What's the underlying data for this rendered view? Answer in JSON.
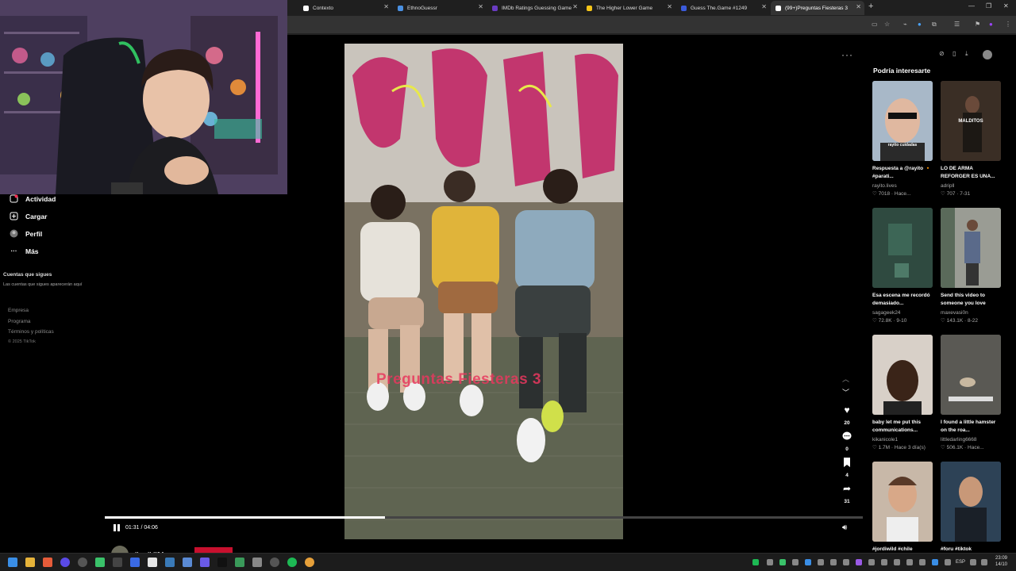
{
  "browser": {
    "tabs": [
      {
        "label": "Contexto",
        "color": "#ffffff"
      },
      {
        "label": "EthnoGuessr",
        "color": "#4a90e2"
      },
      {
        "label": "IMDb Ratings Guessing Game",
        "color": "#6a3cc2"
      },
      {
        "label": "The Higher Lower Game",
        "color": "#f5c518"
      },
      {
        "label": "Guess The.Game #1249",
        "color": "#3b5bdb"
      },
      {
        "label": "(99+)Preguntas Fiesteras 3",
        "color": "#ffffff",
        "active": true
      }
    ],
    "new_tab": "+",
    "window_controls": [
      "—",
      "❐",
      "✕"
    ]
  },
  "sidebar": {
    "items": [
      {
        "label": "Actividad",
        "icon": "activity-icon"
      },
      {
        "label": "Cargar",
        "icon": "upload-icon"
      },
      {
        "label": "Perfil",
        "icon": "profile-icon"
      },
      {
        "label": "Más",
        "icon": "more-dots-icon"
      }
    ],
    "following_title": "Cuentas que sigues",
    "following_desc": "Las cuentas que sigues aparecerán aquí",
    "footer": [
      "Empresa",
      "Programa",
      "Términos y políticas"
    ],
    "copyright": "© 2025 TikTok"
  },
  "video": {
    "overlay_text": "Preguntas Fiesteras 3",
    "current_time": "01:31",
    "duration": "04:06",
    "time_display": "01:31 / 04:06",
    "progress": 0.37,
    "author": "jbaaibil04"
  },
  "actions": {
    "likes": "20",
    "comments": "0",
    "saves": "4",
    "shares": "31"
  },
  "recommendations": {
    "title": "Podría interesarte",
    "items": [
      {
        "title": "Respuesta a @rayito 🔸 #parati...",
        "author": "rayito.lives",
        "stats": "♡ 7018 · Hace...",
        "thumb_text": "rayito cuidadas",
        "bg": "#8aa0b4"
      },
      {
        "title": "LO DE ARMA REFORGER ES UNA...",
        "author": "adripll",
        "stats": "♡ 707 · 7-31",
        "thumb_text": "MALDITOS",
        "bg": "#3a2e25"
      },
      {
        "title": "Esa escena me recordó demasiado...",
        "author": "sagageek24",
        "stats": "♡ 72.8K · 9-10",
        "thumb_text": "",
        "bg": "#2f4a40"
      },
      {
        "title": "Send this video to someone you love",
        "author": "maxevasi0n",
        "stats": "♡ 143.1K · 8-22",
        "thumb_text": "",
        "bg": "#6b6f6a"
      },
      {
        "title": "baby let me put this communications...",
        "author": "kikanicole1",
        "stats": "♡ 1.7M · Hace 3 día(s)",
        "thumb_text": "",
        "bg": "#3c2e28"
      },
      {
        "title": "I found a little hamster on the roa...",
        "author": "littledarling6668",
        "stats": "♡ 506.1K · Hace...",
        "thumb_text": "",
        "bg": "#4b4a46"
      },
      {
        "title": "#jordiwild #chile",
        "author": "",
        "stats": "",
        "thumb_text": "",
        "bg": "#b08a6e"
      },
      {
        "title": "#foru #tiktok",
        "author": "",
        "stats": "",
        "thumb_text": "",
        "bg": "#2d4256"
      }
    ]
  },
  "taskbar": {
    "lang": "ESP",
    "time": "23:09",
    "date": "14/10"
  }
}
